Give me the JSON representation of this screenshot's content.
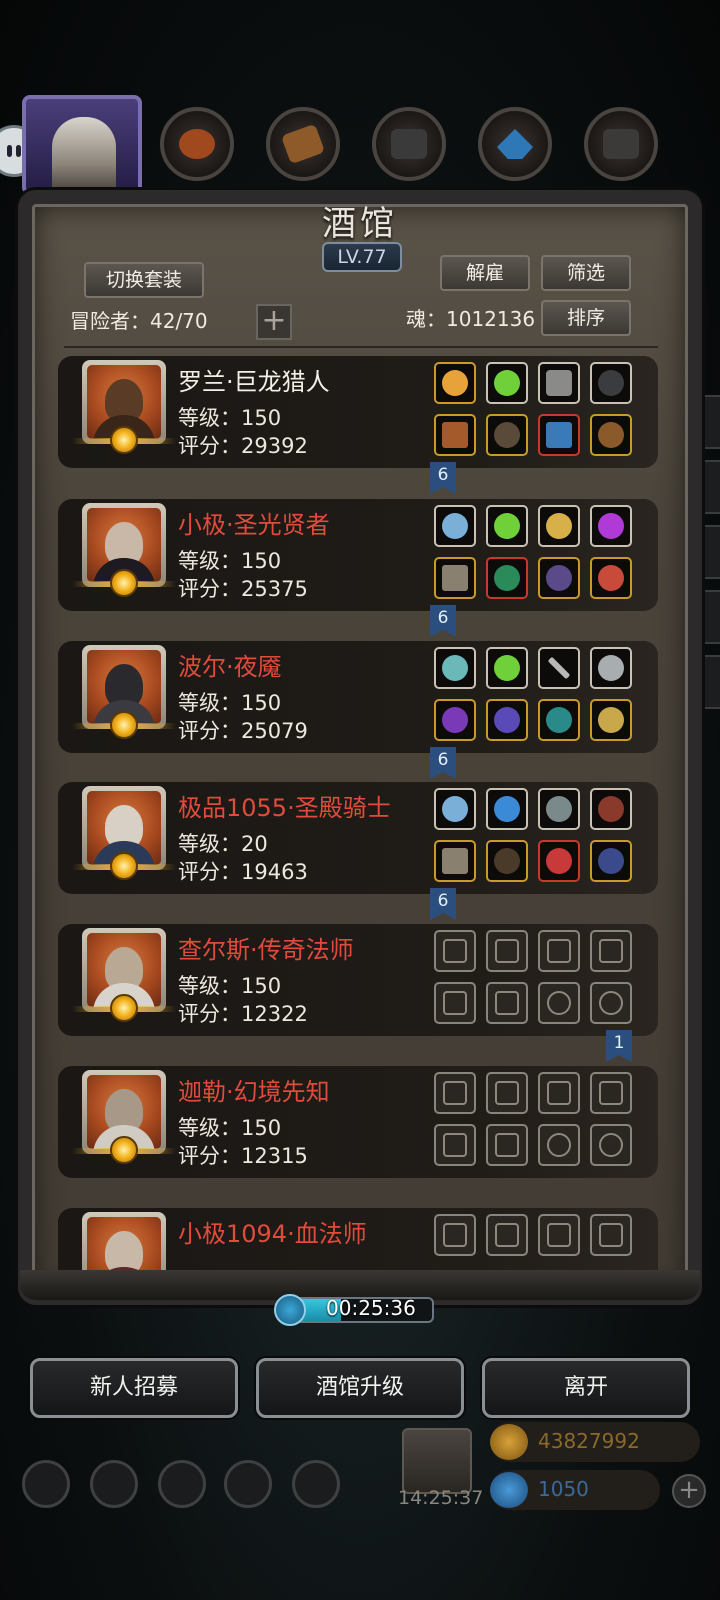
{
  "panel": {
    "title": "酒馆",
    "level": "LV.77",
    "switch_set_label": "切换套装",
    "dismiss_label": "解雇",
    "filter_label": "筛选",
    "sort_label": "排序",
    "adventurers": "冒险者：42/70",
    "soul": "魂：1012136",
    "plus": "+"
  },
  "heroes": [
    {
      "name": "罗兰·巨龙猎人",
      "name_color": "white",
      "level": "等级：150",
      "score": "评分：29392",
      "tag": "6"
    },
    {
      "name": "小极·圣光贤者",
      "name_color": "red",
      "level": "等级：150",
      "score": "评分：25375",
      "tag": "6"
    },
    {
      "name": "波尔·夜魇",
      "name_color": "red",
      "level": "等级：150",
      "score": "评分：25079",
      "tag": "6"
    },
    {
      "name": "极品1055·圣殿骑士",
      "name_color": "red",
      "level": "等级：20",
      "score": "评分：19463",
      "tag": "6"
    },
    {
      "name": "查尔斯·传奇法师",
      "name_color": "red",
      "level": "等级：150",
      "score": "评分：12322",
      "tag": "1"
    },
    {
      "name": "迦勒·幻境先知",
      "name_color": "red",
      "level": "等级：150",
      "score": "评分：12315",
      "tag": ""
    },
    {
      "name": "小极1094·血法师",
      "name_color": "red",
      "level": "",
      "score": "",
      "tag": ""
    }
  ],
  "timer": {
    "text": "00:25:36",
    "progress": 0.35
  },
  "bottom": {
    "recruit_label": "新人招募",
    "upgrade_label": "酒馆升级",
    "leave_label": "离开",
    "gift_timer": "14:25:37",
    "gold": "43827992",
    "gems": "1050"
  },
  "colors": {
    "accent_red": "#e04c3c",
    "timer_fill": "#35c7e0",
    "tag_blue": "#2a4f7e"
  }
}
